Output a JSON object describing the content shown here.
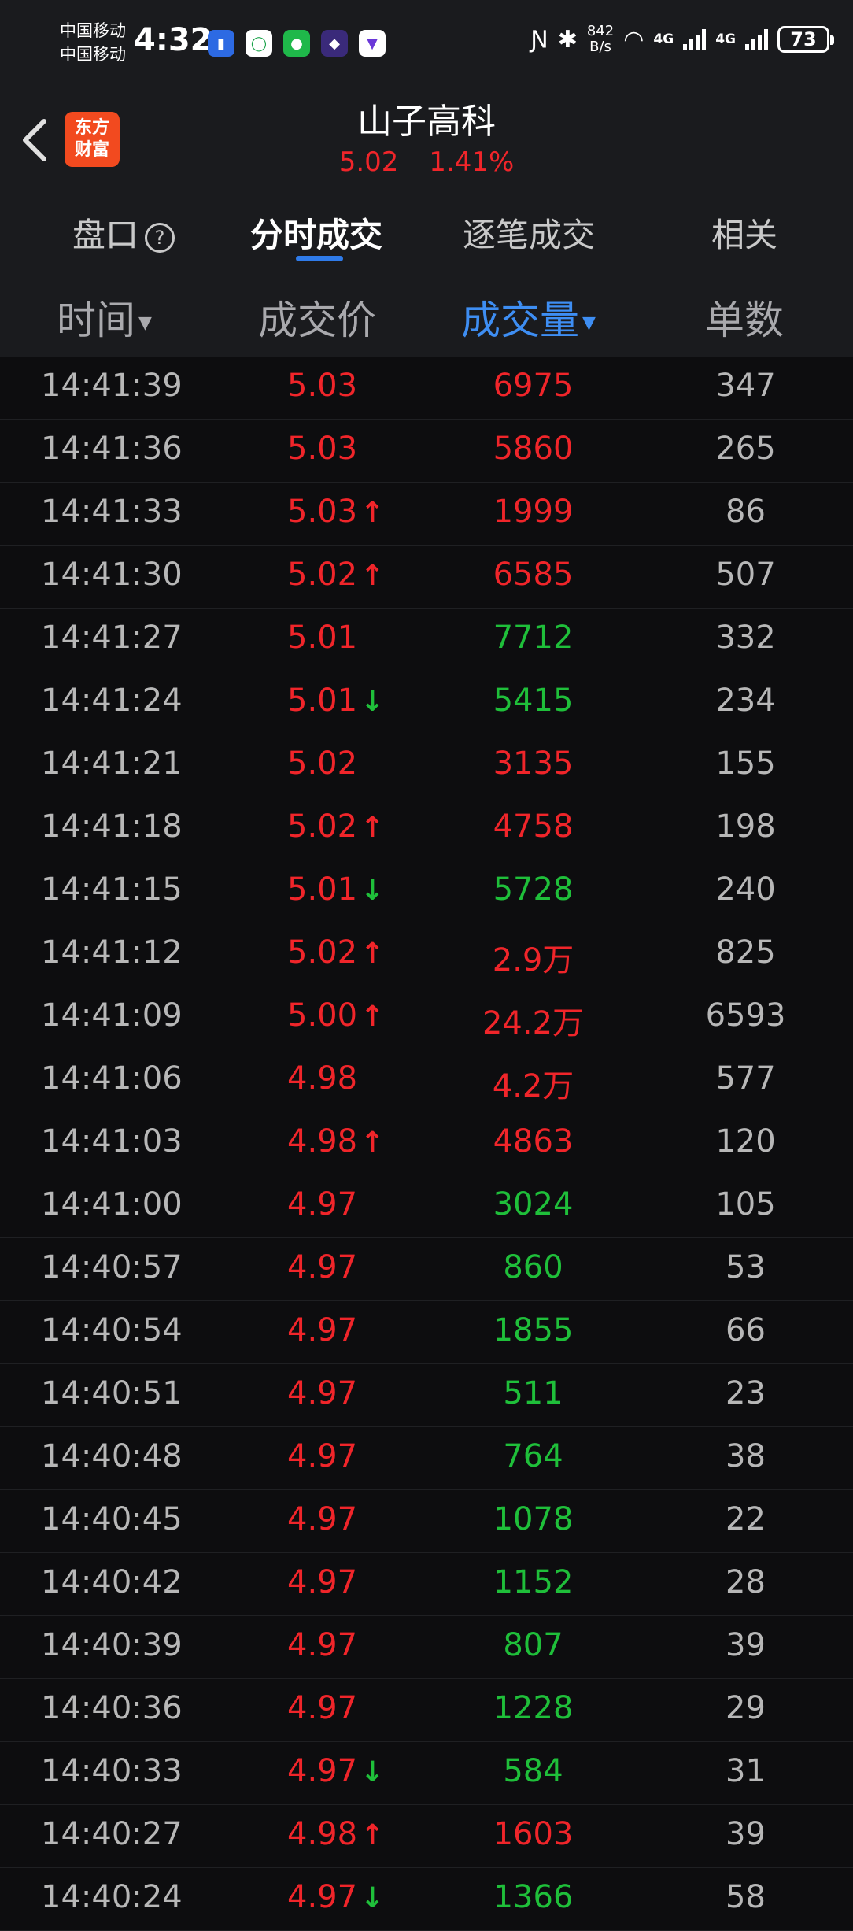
{
  "status_bar": {
    "carrier_1": "中国移动",
    "carrier_2": "中国移动",
    "time": "4:32",
    "net_speed_value": "842",
    "net_speed_unit": "B/s",
    "net_type_1": "4G",
    "net_type_2": "4G",
    "battery": "73"
  },
  "header": {
    "logo_line1": "东方",
    "logo_line2": "财富",
    "stock_name": "山子高科",
    "price": "5.02",
    "change_pct": "1.41%"
  },
  "tabs": [
    {
      "label": "盘口",
      "active": false
    },
    {
      "label": "分时成交",
      "active": true
    },
    {
      "label": "逐笔成交",
      "active": false
    },
    {
      "label": "相关",
      "active": false
    }
  ],
  "columns": {
    "time": "时间",
    "price": "成交价",
    "volume": "成交量",
    "count": "单数"
  },
  "colors": {
    "up": "#f0252a",
    "down": "#1fbf3a",
    "accent": "#3e8ef3"
  },
  "trades": [
    {
      "time": "14:41:39",
      "price": "5.03",
      "dir": "",
      "volume": "6975",
      "vol_color": "red",
      "count": "347"
    },
    {
      "time": "14:41:36",
      "price": "5.03",
      "dir": "",
      "volume": "5860",
      "vol_color": "red",
      "count": "265"
    },
    {
      "time": "14:41:33",
      "price": "5.03",
      "dir": "up",
      "volume": "1999",
      "vol_color": "red",
      "count": "86"
    },
    {
      "time": "14:41:30",
      "price": "5.02",
      "dir": "up",
      "volume": "6585",
      "vol_color": "red",
      "count": "507"
    },
    {
      "time": "14:41:27",
      "price": "5.01",
      "dir": "",
      "volume": "7712",
      "vol_color": "green",
      "count": "332"
    },
    {
      "time": "14:41:24",
      "price": "5.01",
      "dir": "down",
      "volume": "5415",
      "vol_color": "green",
      "count": "234"
    },
    {
      "time": "14:41:21",
      "price": "5.02",
      "dir": "",
      "volume": "3135",
      "vol_color": "red",
      "count": "155"
    },
    {
      "time": "14:41:18",
      "price": "5.02",
      "dir": "up",
      "volume": "4758",
      "vol_color": "red",
      "count": "198"
    },
    {
      "time": "14:41:15",
      "price": "5.01",
      "dir": "down",
      "volume": "5728",
      "vol_color": "green",
      "count": "240"
    },
    {
      "time": "14:41:12",
      "price": "5.02",
      "dir": "up",
      "volume": "2.9万",
      "vol_color": "red",
      "count": "825"
    },
    {
      "time": "14:41:09",
      "price": "5.00",
      "dir": "up",
      "volume": "24.2万",
      "vol_color": "red",
      "count": "6593"
    },
    {
      "time": "14:41:06",
      "price": "4.98",
      "dir": "",
      "volume": "4.2万",
      "vol_color": "red",
      "count": "577"
    },
    {
      "time": "14:41:03",
      "price": "4.98",
      "dir": "up",
      "volume": "4863",
      "vol_color": "red",
      "count": "120"
    },
    {
      "time": "14:41:00",
      "price": "4.97",
      "dir": "",
      "volume": "3024",
      "vol_color": "green",
      "count": "105"
    },
    {
      "time": "14:40:57",
      "price": "4.97",
      "dir": "",
      "volume": "860",
      "vol_color": "green",
      "count": "53"
    },
    {
      "time": "14:40:54",
      "price": "4.97",
      "dir": "",
      "volume": "1855",
      "vol_color": "green",
      "count": "66"
    },
    {
      "time": "14:40:51",
      "price": "4.97",
      "dir": "",
      "volume": "511",
      "vol_color": "green",
      "count": "23"
    },
    {
      "time": "14:40:48",
      "price": "4.97",
      "dir": "",
      "volume": "764",
      "vol_color": "green",
      "count": "38"
    },
    {
      "time": "14:40:45",
      "price": "4.97",
      "dir": "",
      "volume": "1078",
      "vol_color": "green",
      "count": "22"
    },
    {
      "time": "14:40:42",
      "price": "4.97",
      "dir": "",
      "volume": "1152",
      "vol_color": "green",
      "count": "28"
    },
    {
      "time": "14:40:39",
      "price": "4.97",
      "dir": "",
      "volume": "807",
      "vol_color": "green",
      "count": "39"
    },
    {
      "time": "14:40:36",
      "price": "4.97",
      "dir": "",
      "volume": "1228",
      "vol_color": "green",
      "count": "29"
    },
    {
      "time": "14:40:33",
      "price": "4.97",
      "dir": "down",
      "volume": "584",
      "vol_color": "green",
      "count": "31"
    },
    {
      "time": "14:40:27",
      "price": "4.98",
      "dir": "up",
      "volume": "1603",
      "vol_color": "red",
      "count": "39"
    },
    {
      "time": "14:40:24",
      "price": "4.97",
      "dir": "down",
      "volume": "1366",
      "vol_color": "green",
      "count": "58"
    }
  ]
}
